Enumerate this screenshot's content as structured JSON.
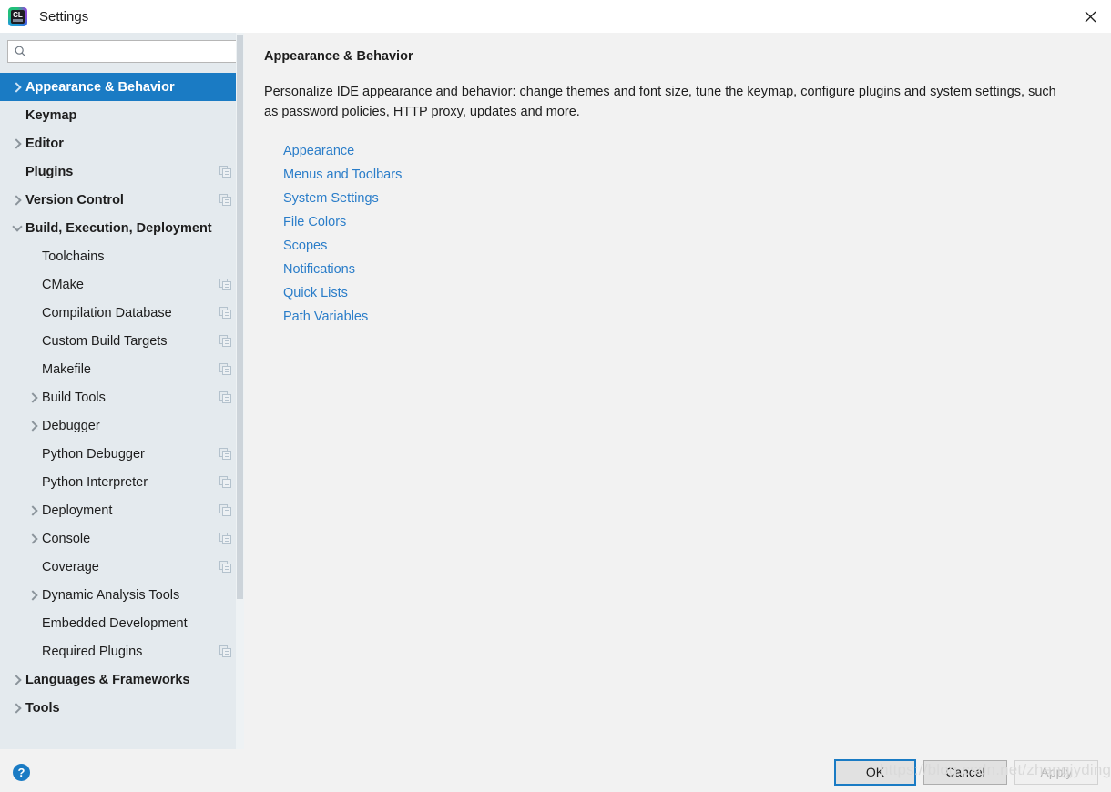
{
  "window": {
    "title": "Settings",
    "app_icon": "clion-logo-icon",
    "close_icon": "close-icon"
  },
  "search": {
    "value": "",
    "placeholder": "",
    "icon": "search-icon"
  },
  "sidebar": {
    "items": [
      {
        "label": "Appearance & Behavior",
        "level": 0,
        "chevron": "right",
        "selected": true,
        "copy_icon": false
      },
      {
        "label": "Keymap",
        "level": 0,
        "chevron": "none",
        "selected": false,
        "copy_icon": false
      },
      {
        "label": "Editor",
        "level": 0,
        "chevron": "right",
        "selected": false,
        "copy_icon": false
      },
      {
        "label": "Plugins",
        "level": 0,
        "chevron": "none",
        "selected": false,
        "copy_icon": true
      },
      {
        "label": "Version Control",
        "level": 0,
        "chevron": "right",
        "selected": false,
        "copy_icon": true
      },
      {
        "label": "Build, Execution, Deployment",
        "level": 0,
        "chevron": "down",
        "selected": false,
        "copy_icon": false
      },
      {
        "label": "Toolchains",
        "level": 1,
        "chevron": "none",
        "selected": false,
        "copy_icon": false
      },
      {
        "label": "CMake",
        "level": 1,
        "chevron": "none",
        "selected": false,
        "copy_icon": true
      },
      {
        "label": "Compilation Database",
        "level": 1,
        "chevron": "none",
        "selected": false,
        "copy_icon": true
      },
      {
        "label": "Custom Build Targets",
        "level": 1,
        "chevron": "none",
        "selected": false,
        "copy_icon": true
      },
      {
        "label": "Makefile",
        "level": 1,
        "chevron": "none",
        "selected": false,
        "copy_icon": true
      },
      {
        "label": "Build Tools",
        "level": 1,
        "chevron": "right",
        "selected": false,
        "copy_icon": true
      },
      {
        "label": "Debugger",
        "level": 1,
        "chevron": "right",
        "selected": false,
        "copy_icon": false
      },
      {
        "label": "Python Debugger",
        "level": 1,
        "chevron": "none",
        "selected": false,
        "copy_icon": true
      },
      {
        "label": "Python Interpreter",
        "level": 1,
        "chevron": "none",
        "selected": false,
        "copy_icon": true
      },
      {
        "label": "Deployment",
        "level": 1,
        "chevron": "right",
        "selected": false,
        "copy_icon": true
      },
      {
        "label": "Console",
        "level": 1,
        "chevron": "right",
        "selected": false,
        "copy_icon": true
      },
      {
        "label": "Coverage",
        "level": 1,
        "chevron": "none",
        "selected": false,
        "copy_icon": true
      },
      {
        "label": "Dynamic Analysis Tools",
        "level": 1,
        "chevron": "right",
        "selected": false,
        "copy_icon": false
      },
      {
        "label": "Embedded Development",
        "level": 1,
        "chevron": "none",
        "selected": false,
        "copy_icon": false
      },
      {
        "label": "Required Plugins",
        "level": 1,
        "chevron": "none",
        "selected": false,
        "copy_icon": true
      },
      {
        "label": "Languages & Frameworks",
        "level": 0,
        "chevron": "right",
        "selected": false,
        "copy_icon": false
      },
      {
        "label": "Tools",
        "level": 0,
        "chevron": "right",
        "selected": false,
        "copy_icon": false
      }
    ]
  },
  "main": {
    "title": "Appearance & Behavior",
    "description": "Personalize IDE appearance and behavior: change themes and font size, tune the keymap, configure plugins and system settings, such as password policies, HTTP proxy, updates and more.",
    "links": [
      "Appearance",
      "Menus and Toolbars",
      "System Settings",
      "File Colors",
      "Scopes",
      "Notifications",
      "Quick Lists",
      "Path Variables"
    ]
  },
  "footer": {
    "help_label": "?",
    "ok_label": "OK",
    "cancel_label": "Cancel",
    "apply_label": "Apply"
  },
  "watermark": {
    "text": "https://blog.csdn.net/zhangjyding"
  },
  "colors": {
    "accent": "#1a7bc4",
    "sidebar_bg": "#e4eaee",
    "content_bg": "#f2f2f2",
    "link": "#2a7dc9"
  }
}
